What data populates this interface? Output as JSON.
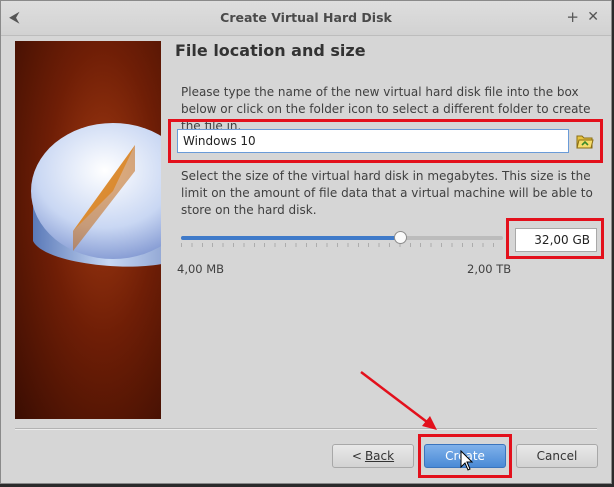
{
  "window": {
    "title": "Create Virtual Hard Disk",
    "back_glyph": "⮜",
    "plus_glyph": "+",
    "close_glyph": "✕"
  },
  "page": {
    "heading": "File location and size",
    "location_description": "Please type the name of the new virtual hard disk file into the box below or click on the folder icon to select a different folder to create the file in.",
    "file_name": "Windows 10",
    "size_description": "Select the size of the virtual hard disk in megabytes. This size is the limit on the amount of file data that a virtual machine will be able to store on the hard disk.",
    "size_value": "32,00 GB",
    "slider_fraction": 0.68,
    "min_label": "4,00 MB",
    "max_label": "2,00 TB"
  },
  "buttons": {
    "back_arrow": "<",
    "back_label": "Back",
    "create_label": "Create",
    "cancel_label": "Cancel"
  },
  "icons": {
    "folder": "folder-open-icon",
    "disk_image": "hard-disk-pie-icon",
    "cursor": "mouse-pointer-icon"
  },
  "colors": {
    "highlight": "#e3101c",
    "accent": "#3f7ac9",
    "default_button": "#4a8ad6"
  }
}
